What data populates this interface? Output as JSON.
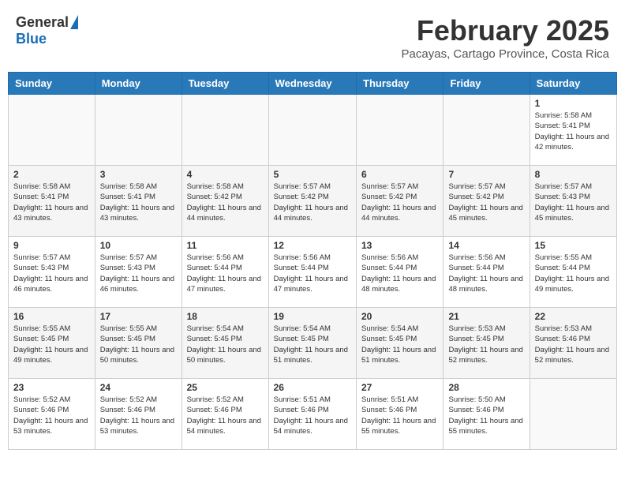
{
  "header": {
    "logo_general": "General",
    "logo_blue": "Blue",
    "title": "February 2025",
    "location": "Pacayas, Cartago Province, Costa Rica"
  },
  "days_of_week": [
    "Sunday",
    "Monday",
    "Tuesday",
    "Wednesday",
    "Thursday",
    "Friday",
    "Saturday"
  ],
  "weeks": [
    [
      {
        "day": "",
        "info": ""
      },
      {
        "day": "",
        "info": ""
      },
      {
        "day": "",
        "info": ""
      },
      {
        "day": "",
        "info": ""
      },
      {
        "day": "",
        "info": ""
      },
      {
        "day": "",
        "info": ""
      },
      {
        "day": "1",
        "info": "Sunrise: 5:58 AM\nSunset: 5:41 PM\nDaylight: 11 hours\nand 42 minutes."
      }
    ],
    [
      {
        "day": "2",
        "info": "Sunrise: 5:58 AM\nSunset: 5:41 PM\nDaylight: 11 hours\nand 43 minutes."
      },
      {
        "day": "3",
        "info": "Sunrise: 5:58 AM\nSunset: 5:41 PM\nDaylight: 11 hours\nand 43 minutes."
      },
      {
        "day": "4",
        "info": "Sunrise: 5:58 AM\nSunset: 5:42 PM\nDaylight: 11 hours\nand 44 minutes."
      },
      {
        "day": "5",
        "info": "Sunrise: 5:57 AM\nSunset: 5:42 PM\nDaylight: 11 hours\nand 44 minutes."
      },
      {
        "day": "6",
        "info": "Sunrise: 5:57 AM\nSunset: 5:42 PM\nDaylight: 11 hours\nand 44 minutes."
      },
      {
        "day": "7",
        "info": "Sunrise: 5:57 AM\nSunset: 5:42 PM\nDaylight: 11 hours\nand 45 minutes."
      },
      {
        "day": "8",
        "info": "Sunrise: 5:57 AM\nSunset: 5:43 PM\nDaylight: 11 hours\nand 45 minutes."
      }
    ],
    [
      {
        "day": "9",
        "info": "Sunrise: 5:57 AM\nSunset: 5:43 PM\nDaylight: 11 hours\nand 46 minutes."
      },
      {
        "day": "10",
        "info": "Sunrise: 5:57 AM\nSunset: 5:43 PM\nDaylight: 11 hours\nand 46 minutes."
      },
      {
        "day": "11",
        "info": "Sunrise: 5:56 AM\nSunset: 5:44 PM\nDaylight: 11 hours\nand 47 minutes."
      },
      {
        "day": "12",
        "info": "Sunrise: 5:56 AM\nSunset: 5:44 PM\nDaylight: 11 hours\nand 47 minutes."
      },
      {
        "day": "13",
        "info": "Sunrise: 5:56 AM\nSunset: 5:44 PM\nDaylight: 11 hours\nand 48 minutes."
      },
      {
        "day": "14",
        "info": "Sunrise: 5:56 AM\nSunset: 5:44 PM\nDaylight: 11 hours\nand 48 minutes."
      },
      {
        "day": "15",
        "info": "Sunrise: 5:55 AM\nSunset: 5:44 PM\nDaylight: 11 hours\nand 49 minutes."
      }
    ],
    [
      {
        "day": "16",
        "info": "Sunrise: 5:55 AM\nSunset: 5:45 PM\nDaylight: 11 hours\nand 49 minutes."
      },
      {
        "day": "17",
        "info": "Sunrise: 5:55 AM\nSunset: 5:45 PM\nDaylight: 11 hours\nand 50 minutes."
      },
      {
        "day": "18",
        "info": "Sunrise: 5:54 AM\nSunset: 5:45 PM\nDaylight: 11 hours\nand 50 minutes."
      },
      {
        "day": "19",
        "info": "Sunrise: 5:54 AM\nSunset: 5:45 PM\nDaylight: 11 hours\nand 51 minutes."
      },
      {
        "day": "20",
        "info": "Sunrise: 5:54 AM\nSunset: 5:45 PM\nDaylight: 11 hours\nand 51 minutes."
      },
      {
        "day": "21",
        "info": "Sunrise: 5:53 AM\nSunset: 5:45 PM\nDaylight: 11 hours\nand 52 minutes."
      },
      {
        "day": "22",
        "info": "Sunrise: 5:53 AM\nSunset: 5:46 PM\nDaylight: 11 hours\nand 52 minutes."
      }
    ],
    [
      {
        "day": "23",
        "info": "Sunrise: 5:52 AM\nSunset: 5:46 PM\nDaylight: 11 hours\nand 53 minutes."
      },
      {
        "day": "24",
        "info": "Sunrise: 5:52 AM\nSunset: 5:46 PM\nDaylight: 11 hours\nand 53 minutes."
      },
      {
        "day": "25",
        "info": "Sunrise: 5:52 AM\nSunset: 5:46 PM\nDaylight: 11 hours\nand 54 minutes."
      },
      {
        "day": "26",
        "info": "Sunrise: 5:51 AM\nSunset: 5:46 PM\nDaylight: 11 hours\nand 54 minutes."
      },
      {
        "day": "27",
        "info": "Sunrise: 5:51 AM\nSunset: 5:46 PM\nDaylight: 11 hours\nand 55 minutes."
      },
      {
        "day": "28",
        "info": "Sunrise: 5:50 AM\nSunset: 5:46 PM\nDaylight: 11 hours\nand 55 minutes."
      },
      {
        "day": "",
        "info": ""
      }
    ]
  ]
}
